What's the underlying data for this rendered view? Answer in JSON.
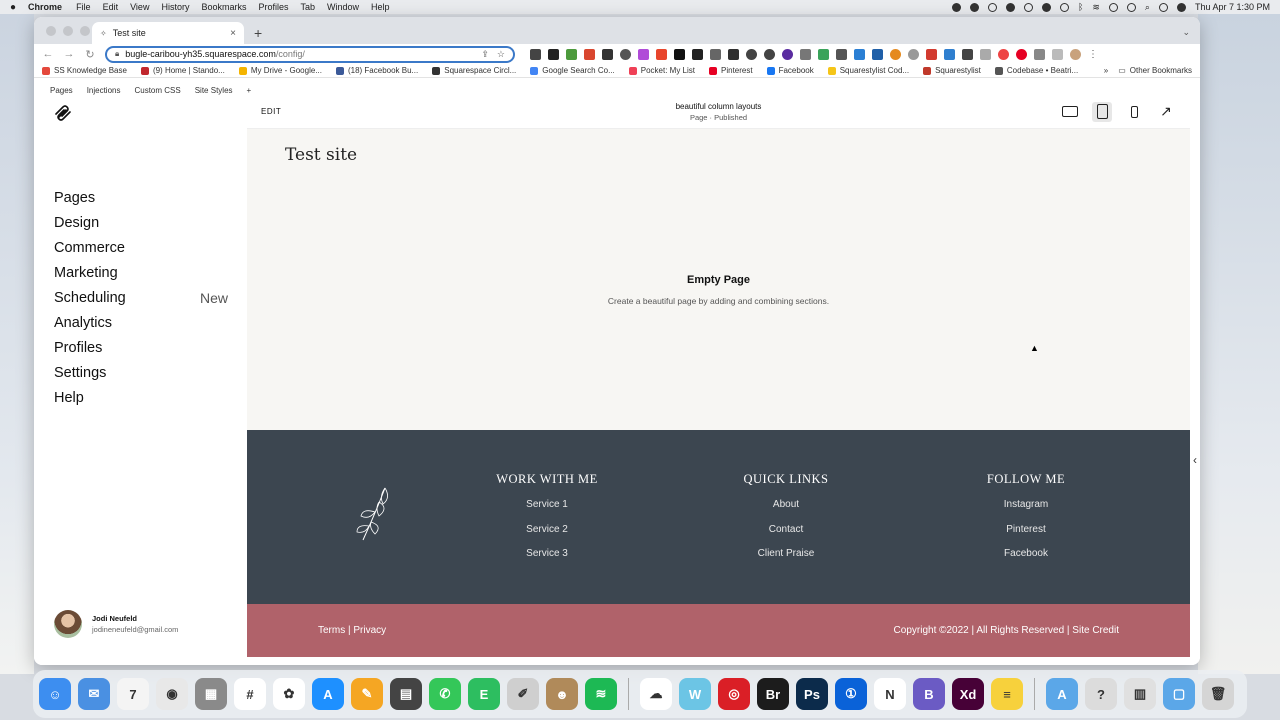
{
  "menubar": {
    "app_name": "Chrome",
    "menus": [
      "File",
      "Edit",
      "View",
      "History",
      "Bookmarks",
      "Profiles",
      "Tab",
      "Window",
      "Help"
    ],
    "clock": "Thu Apr 7  1:30 PM"
  },
  "browser": {
    "tab_title": "Test site",
    "url_host": "bugle-caribou-yh35.squarespace.com",
    "url_path": "/config/",
    "bookmarks": [
      {
        "label": "SS Knowledge Base",
        "color": "#e4483c"
      },
      {
        "label": "(9) Home | Stando...",
        "color": "#c1272d"
      },
      {
        "label": "My Drive - Google...",
        "color": "#f4b400"
      },
      {
        "label": "(18) Facebook Bu...",
        "color": "#3b5998"
      },
      {
        "label": "Squarespace Circl...",
        "color": "#333333"
      },
      {
        "label": "Google Search Co...",
        "color": "#4285f4"
      },
      {
        "label": "Pocket: My List",
        "color": "#ef4056"
      },
      {
        "label": "Pinterest",
        "color": "#e60023"
      },
      {
        "label": "Facebook",
        "color": "#1877f2"
      },
      {
        "label": "Squarestylist Cod...",
        "color": "#f5c518"
      },
      {
        "label": "Squarestylist",
        "color": "#c0392b"
      },
      {
        "label": "Codebase • Beatri...",
        "color": "#555555"
      }
    ],
    "other_bookmarks": "Other Bookmarks",
    "overflow": "»"
  },
  "admin": {
    "topnav": [
      "Pages",
      "Injections",
      "Custom CSS",
      "Site Styles",
      "+"
    ],
    "nav_items": [
      {
        "label": "Pages",
        "badge": ""
      },
      {
        "label": "Design",
        "badge": ""
      },
      {
        "label": "Commerce",
        "badge": ""
      },
      {
        "label": "Marketing",
        "badge": ""
      },
      {
        "label": "Scheduling",
        "badge": "New"
      },
      {
        "label": "Analytics",
        "badge": ""
      },
      {
        "label": "Profiles",
        "badge": ""
      },
      {
        "label": "Settings",
        "badge": ""
      },
      {
        "label": "Help",
        "badge": ""
      }
    ],
    "user": {
      "name": "Jodi Neufeld",
      "email": "jodineneufeld@gmail.com"
    }
  },
  "editor": {
    "edit_label": "EDIT",
    "page_name": "beautiful column layouts",
    "page_status": "Page · Published",
    "view_modes": [
      "desktop-view-icon",
      "tablet-view-icon",
      "mobile-view-icon",
      "open-external-icon"
    ]
  },
  "site": {
    "title": "Test site",
    "empty_title": "Empty Page",
    "empty_desc": "Create a beautiful page by adding and combining sections.",
    "footer": {
      "columns": [
        {
          "heading": "WORK WITH ME",
          "links": [
            "Service 1",
            "Service 2",
            "Service 3"
          ]
        },
        {
          "heading": "QUICK LINKS",
          "links": [
            "About",
            "Contact",
            "Client Praise"
          ]
        },
        {
          "heading": "FOLLOW ME",
          "links": [
            "Instagram",
            "Pinterest",
            "Facebook"
          ]
        }
      ],
      "legal_left": "Terms | Privacy",
      "legal_right": "Copyright ©2022  |   All Rights Reserved  |  Site Credit"
    },
    "colors": {
      "footer_bg": "#3c4650",
      "bottom_bar_bg": "#b0626a"
    }
  },
  "dock": {
    "apps": [
      {
        "icon": "finder-icon",
        "color": "#3d8ef0",
        "glyph": "☺"
      },
      {
        "icon": "mail-icon",
        "color": "#4a90e2",
        "glyph": "✉"
      },
      {
        "icon": "calendar-icon",
        "color": "#f4f4f4",
        "glyph": "7"
      },
      {
        "icon": "chrome-icon",
        "color": "#e8e8e8",
        "glyph": "◉"
      },
      {
        "icon": "launchpad-icon",
        "color": "#8a8a8a",
        "glyph": "▦"
      },
      {
        "icon": "slack-icon",
        "color": "#ffffff",
        "glyph": "#"
      },
      {
        "icon": "photos-icon",
        "color": "#ffffff",
        "glyph": "✿"
      },
      {
        "icon": "app-store-icon",
        "color": "#1e90ff",
        "glyph": "A"
      },
      {
        "icon": "pages-icon",
        "color": "#f5a623",
        "glyph": "✎"
      },
      {
        "icon": "printer-icon",
        "color": "#444444",
        "glyph": "▤"
      },
      {
        "icon": "messages-icon",
        "color": "#34c759",
        "glyph": "✆"
      },
      {
        "icon": "evernote-icon",
        "color": "#2dbe60",
        "glyph": "E"
      },
      {
        "icon": "script-editor-icon",
        "color": "#cfcfcf",
        "glyph": "✐"
      },
      {
        "icon": "contacts-icon",
        "color": "#b08a5a",
        "glyph": "☻"
      },
      {
        "icon": "spotify-icon",
        "color": "#1db954",
        "glyph": "≋"
      },
      {
        "icon": "creative-cloud-icon",
        "color": "#ffffff",
        "glyph": "☁"
      },
      {
        "icon": "webflow-icon",
        "color": "#6cc5e5",
        "glyph": "W"
      },
      {
        "icon": "adobe-cc-icon",
        "color": "#da1f26",
        "glyph": "◎"
      },
      {
        "icon": "bridge-icon",
        "color": "#1c1c1c",
        "glyph": "Br"
      },
      {
        "icon": "photoshop-icon",
        "color": "#0c2b4b",
        "glyph": "Ps"
      },
      {
        "icon": "1password-icon",
        "color": "#0a62d8",
        "glyph": "①"
      },
      {
        "icon": "notion-icon",
        "color": "#ffffff",
        "glyph": "N"
      },
      {
        "icon": "bbedit-icon",
        "color": "#6b5bc4",
        "glyph": "B"
      },
      {
        "icon": "xd-icon",
        "color": "#470137",
        "glyph": "Xd"
      },
      {
        "icon": "notes-icon",
        "color": "#f7d13c",
        "glyph": "≡"
      },
      {
        "icon": "applications-folder-icon",
        "color": "#5ba7e8",
        "glyph": "A"
      },
      {
        "icon": "unknown-app-icon",
        "color": "#dcdcdc",
        "glyph": "?"
      },
      {
        "icon": "archive-icon",
        "color": "#e0e0e0",
        "glyph": "▥"
      },
      {
        "icon": "downloads-folder-icon",
        "color": "#5ba7e8",
        "glyph": "▢"
      },
      {
        "icon": "trash-icon",
        "color": "#d5d5d5",
        "glyph": "🗑"
      }
    ]
  }
}
